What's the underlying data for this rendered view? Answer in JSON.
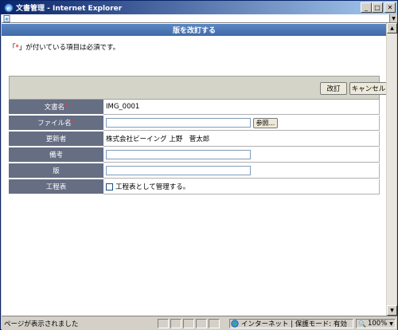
{
  "window": {
    "title": "文書管理 - Internet Explorer",
    "minimize_label": "_",
    "maximize_label": "□",
    "close_label": "✕"
  },
  "header": {
    "title": "版を改訂する"
  },
  "notice": {
    "prefix": "「",
    "mark": "*",
    "suffix": "」が付いている項目は必須です。"
  },
  "toolbar": {
    "save_label": "改訂",
    "cancel_label": "キャンセル"
  },
  "form": {
    "doc_name": {
      "label": "文書名",
      "required_mark": "*",
      "value": "IMG_0001"
    },
    "file_name": {
      "label": "ファイル名",
      "required_mark": "*",
      "value": "",
      "browse_label": "参照..."
    },
    "updater": {
      "label": "更新者",
      "value": "株式会社ビーイング 上野　菅太郎"
    },
    "remarks": {
      "label": "備考",
      "value": ""
    },
    "version": {
      "label": "版",
      "value": ""
    },
    "process": {
      "label": "工程表",
      "checkbox_label": "工程表として管理する。",
      "checked": false
    }
  },
  "statusbar": {
    "text": "ページが表示されました",
    "zone": "インターネット | 保護モード: 有効",
    "zoom": "100%"
  },
  "colors": {
    "title_gradient_start": "#0a246a",
    "header_blue": "#4a76b4",
    "label_bg": "#666e83",
    "required_red": "#d00000"
  },
  "icons": [
    "ie-logo-icon",
    "page-icon",
    "globe-icon",
    "zoom-icon"
  ]
}
